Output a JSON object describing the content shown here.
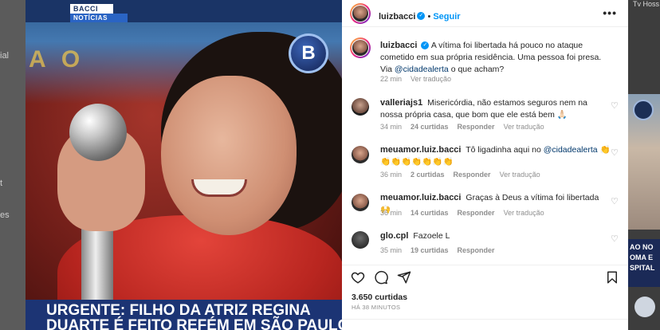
{
  "background": {
    "left_texts": [
      "ial",
      "t",
      "es"
    ],
    "right_top_text": "Tv Hoss",
    "right_caption_lines": [
      "AO NO",
      "OMA E",
      "SPITAL"
    ]
  },
  "post": {
    "brand_top": "BACCI",
    "brand_bottom": "NOTÍCIAS",
    "channel_logo": "B",
    "stage_letters": "A O",
    "headline_line1": "URGENTE:  FILHO DA ATRIZ REGINA",
    "headline_line2": "DUARTE É FEITO REFÉM EM SÃO PAULO"
  },
  "header": {
    "username": "luizbacci",
    "follow_label": "Seguir",
    "more_label": "•••"
  },
  "caption": {
    "username": "luizbacci",
    "text_before": "A vítima foi libertada há pouco no ataque cometido em sua própria residência. Uma pessoa foi presa. Via ",
    "mention": "@cidadealerta",
    "text_after": " o que acham?",
    "time": "22 min",
    "translate": "Ver tradução"
  },
  "comments": [
    {
      "username": "valleriajs1",
      "text_before": "Misericórdia, não estamos seguros nem na nossa própria casa, que bom que ele está bem 🙏🏻",
      "mention": "",
      "text_after": "",
      "time": "34 min",
      "likes": "24 curtidas",
      "reply": "Responder",
      "translate": "Ver tradução"
    },
    {
      "username": "meuamor.luiz.bacci",
      "text_before": "Tô ligadinha aqui no ",
      "mention": "@cidadealerta",
      "text_after": " 👏 👏👏👏👏👏👏👏",
      "time": "36 min",
      "likes": "2 curtidas",
      "reply": "Responder",
      "translate": "Ver tradução"
    },
    {
      "username": "meuamor.luiz.bacci",
      "text_before": "Graças à Deus a vítima foi libertada 🙌",
      "mention": "",
      "text_after": "",
      "time": "36 min",
      "likes": "14 curtidas",
      "reply": "Responder",
      "translate": "Ver tradução"
    },
    {
      "username": "glo.cpl",
      "text_before": "Fazoele L",
      "mention": "",
      "text_after": "",
      "time": "35 min",
      "likes": "19 curtidas",
      "reply": "Responder",
      "translate": ""
    }
  ],
  "footer": {
    "likes": "3.650 curtidas",
    "time": "HÁ 38 MINUTOS"
  },
  "icons": {
    "like": "heart-icon",
    "comment": "comment-icon",
    "share": "share-icon",
    "save": "bookmark-icon",
    "verified": "verified-badge-icon"
  },
  "colors": {
    "link_blue": "#0095f6",
    "mention": "#00376b",
    "muted": "#8e8e8e",
    "headline_bg": "#1c3474"
  }
}
